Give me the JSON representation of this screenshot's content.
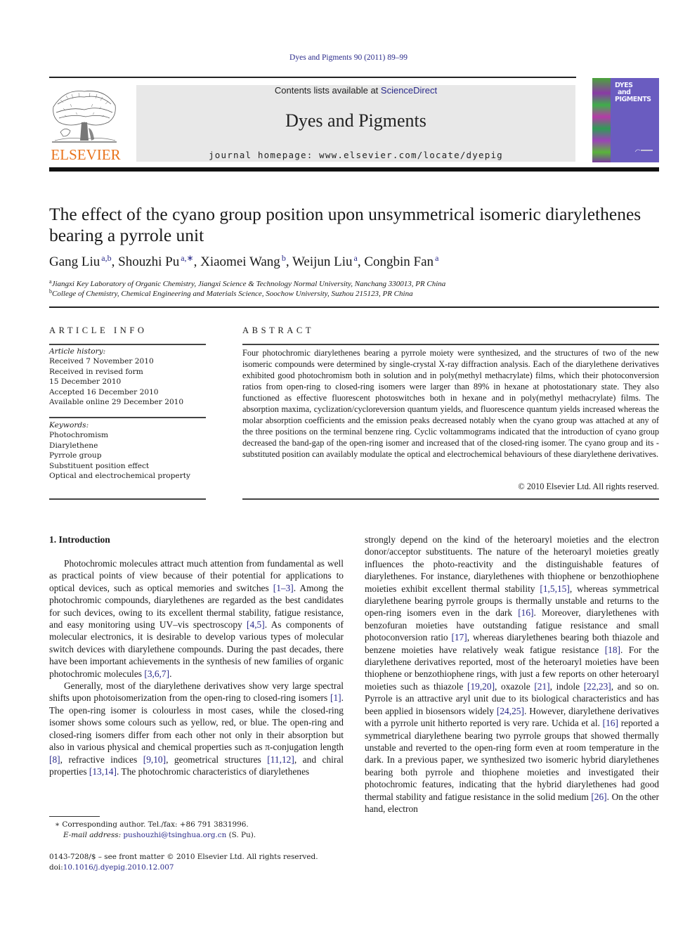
{
  "header": {
    "citation": "Dyes and Pigments 90 (2011) 89–99",
    "contents_prefix": "Contents lists available at ",
    "contents_link": "ScienceDirect",
    "journal_name": "Dyes and Pigments",
    "homepage": "journal homepage: www.elsevier.com/locate/dyepig",
    "publisher_logo_text": "ELSEVIER",
    "cover_title_lines": [
      "DYES",
      "and",
      "PIGMENTS"
    ],
    "colors": {
      "link": "#2a2a8a",
      "elsevier_orange": "#e9731c",
      "masthead_bg": "#e8e8e8",
      "cover_bg": "#6a5cc0"
    }
  },
  "article": {
    "title": "The effect of the cyano group position upon unsymmetrical isomeric diarylethenes bearing a pyrrole unit",
    "authors": [
      {
        "name": "Gang Liu",
        "sup": "a,b"
      },
      {
        "name": "Shouzhi Pu",
        "sup": "a,∗"
      },
      {
        "name": "Xiaomei Wang",
        "sup": "b"
      },
      {
        "name": "Weijun Liu",
        "sup": "a"
      },
      {
        "name": "Congbin Fan",
        "sup": "a"
      }
    ],
    "affiliations": [
      {
        "mark": "a",
        "text": "Jiangxi Key Laboratory of Organic Chemistry, Jiangxi Science & Technology Normal University, Nanchang 330013, PR China"
      },
      {
        "mark": "b",
        "text": "College of Chemistry, Chemical Engineering and Materials Science, Soochow University, Suzhou 215123, PR China"
      }
    ]
  },
  "article_info": {
    "heading": "ARTICLE INFO",
    "history_label": "Article history:",
    "history": [
      "Received 7 November 2010",
      "Received in revised form",
      "15 December 2010",
      "Accepted 16 December 2010",
      "Available online 29 December 2010"
    ],
    "keywords_label": "Keywords:",
    "keywords": [
      "Photochromism",
      "Diarylethene",
      "Pyrrole group",
      "Substituent position effect",
      "Optical and electrochemical property"
    ]
  },
  "abstract": {
    "heading": "ABSTRACT",
    "text": "Four photochromic diarylethenes bearing a pyrrole moiety were synthesized, and the structures of two of the new isomeric compounds were determined by single-crystal X-ray diffraction analysis. Each of the diarylethene derivatives exhibited good photochromism both in solution and in poly(methyl methacrylate) films, which their photoconversion ratios from open-ring to closed-ring isomers were larger than 89% in hexane at photostationary state. They also functioned as effective fluorescent photoswitches both in hexane and in poly(methyl methacrylate) films. The absorption maxima, cyclization/cycloreversion quantum yields, and fluorescence quantum yields increased whereas the molar absorption coefficients and the emission peaks decreased notably when the cyano group was attached at any of the three positions on the terminal benzene ring. Cyclic voltammograms indicated that the introduction of cyano group decreased the band-gap of the open-ring isomer and increased that of the closed-ring isomer. The cyano group and its -substituted position can availably modulate the optical and electrochemical behaviours of these diarylethene derivatives.",
    "copyright": "© 2010 Elsevier Ltd. All rights reserved."
  },
  "introduction": {
    "heading": "1.  Introduction",
    "left_column": [
      {
        "indent": true,
        "segments": [
          {
            "t": "Photochromic molecules attract much attention from fundamental as well as practical points of view because of their potential for applications to optical devices, such as optical memories and switches "
          },
          {
            "t": "[1–3]",
            "ref": true
          },
          {
            "t": ". Among the photochromic compounds, diarylethenes are regarded as the best candidates for such devices, owing to its excellent thermal stability, fatigue resistance, and easy monitoring using UV–vis spectroscopy "
          },
          {
            "t": "[4,5]",
            "ref": true
          },
          {
            "t": ". As components of molecular electronics, it is desirable to develop various types of molecular switch devices with diarylethene compounds. During the past decades, there have been important achievements in the synthesis of new families of organic photochromic molecules "
          },
          {
            "t": "[3,6,7]",
            "ref": true
          },
          {
            "t": "."
          }
        ]
      },
      {
        "indent": true,
        "segments": [
          {
            "t": "Generally, most of the diarylethene derivatives show very large spectral shifts upon photoisomerization from the open-ring to closed-ring isomers "
          },
          {
            "t": "[1]",
            "ref": true
          },
          {
            "t": ". The open-ring isomer is colourless in most cases, while the closed-ring isomer shows some colours such as yellow, red, or blue. The open-ring and closed-ring isomers differ from each other not only in their absorption but also in various physical and chemical properties such as π-conjugation length "
          },
          {
            "t": "[8]",
            "ref": true
          },
          {
            "t": ", refractive indices "
          },
          {
            "t": "[9,10]",
            "ref": true
          },
          {
            "t": ", geometrical structures "
          },
          {
            "t": "[11,12]",
            "ref": true
          },
          {
            "t": ", and chiral properties "
          },
          {
            "t": "[13,14]",
            "ref": true
          },
          {
            "t": ". The photochromic characteristics of diarylethenes"
          }
        ]
      }
    ],
    "right_column": [
      {
        "indent": false,
        "segments": [
          {
            "t": "strongly depend on the kind of the heteroaryl moieties and the electron donor/acceptor substituents. The nature of the heteroaryl moieties greatly influences the photo-reactivity and the distinguishable features of diarylethenes. For instance, diarylethenes with thiophene or benzothiophene moieties exhibit excellent thermal stability "
          },
          {
            "t": "[1,5,15]",
            "ref": true
          },
          {
            "t": ", whereas symmetrical diarylethene bearing pyrrole groups is thermally unstable and returns to the open-ring isomers even in the dark "
          },
          {
            "t": "[16]",
            "ref": true
          },
          {
            "t": ". Moreover, diarylethenes with benzofuran moieties have outstanding fatigue resistance and small photoconversion ratio "
          },
          {
            "t": "[17]",
            "ref": true
          },
          {
            "t": ", whereas diarylethenes bearing both thiazole and benzene moieties have relatively weak fatigue resistance "
          },
          {
            "t": "[18]",
            "ref": true
          },
          {
            "t": ". For the diarylethene derivatives reported, most of the heteroaryl moieties have been thiophene or benzothiophene rings, with just a few reports on other heteroaryl moieties such as thiazole "
          },
          {
            "t": "[19,20]",
            "ref": true
          },
          {
            "t": ", oxazole "
          },
          {
            "t": "[21]",
            "ref": true
          },
          {
            "t": ", indole "
          },
          {
            "t": "[22,23]",
            "ref": true
          },
          {
            "t": ", and so on. Pyrrole is an attractive aryl unit due to its biological characteristics and has been applied in biosensors widely "
          },
          {
            "t": "[24,25]",
            "ref": true
          },
          {
            "t": ". However, diarylethene derivatives with a pyrrole unit hitherto reported is very rare. Uchida et al. "
          },
          {
            "t": "[16]",
            "ref": true
          },
          {
            "t": " reported a symmetrical diarylethene bearing two pyrrole groups that showed thermally unstable and reverted to the open-ring form even at room temperature in the dark. In a previous paper, we synthesized two isomeric hybrid diarylethenes bearing both pyrrole and thiophene moieties and investigated their photochromic features, indicating that the hybrid diarylethenes had good thermal stability and fatigue resistance in the solid medium "
          },
          {
            "t": "[26]",
            "ref": true
          },
          {
            "t": ". On the other hand, electron"
          }
        ]
      }
    ]
  },
  "footnotes": {
    "corresponding": "∗  Corresponding author. Tel./fax: +86 791 3831996.",
    "email_label": "E-mail address: ",
    "email": "pushouzhi@tsinghua.org.cn",
    "email_suffix": " (S. Pu).",
    "issn_line": "0143-7208/$ – see front matter © 2010 Elsevier Ltd. All rights reserved.",
    "doi_label": "doi:",
    "doi": "10.1016/j.dyepig.2010.12.007"
  }
}
